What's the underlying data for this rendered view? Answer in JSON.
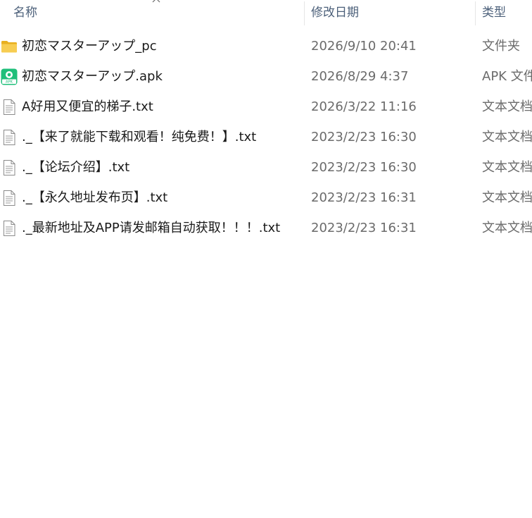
{
  "columns": {
    "name": "名称",
    "modified": "修改日期",
    "type": "类型"
  },
  "sort_icon": "chevron-up-icon",
  "files": [
    {
      "icon": "folder-icon",
      "name": "初恋マスターアップ_pc",
      "modified": "2026/9/10 20:41",
      "type": "文件夹"
    },
    {
      "icon": "apk-icon",
      "name": "初恋マスターアップ.apk",
      "modified": "2026/8/29 4:37",
      "type": "APK 文件"
    },
    {
      "icon": "text-file-icon",
      "name": "A好用又便宜的梯子.txt",
      "modified": "2026/3/22 11:16",
      "type": "文本文档"
    },
    {
      "icon": "text-file-icon",
      "name": "._【来了就能下载和观看！纯免费！】.txt",
      "modified": "2023/2/23 16:30",
      "type": "文本文档"
    },
    {
      "icon": "text-file-icon",
      "name": "._【论坛介绍】.txt",
      "modified": "2023/2/23 16:30",
      "type": "文本文档"
    },
    {
      "icon": "text-file-icon",
      "name": "._【永久地址发布页】.txt",
      "modified": "2023/2/23 16:31",
      "type": "文本文档"
    },
    {
      "icon": "text-file-icon",
      "name": "._最新地址及APP请发邮箱自动获取！！！.txt",
      "modified": "2023/2/23 16:31",
      "type": "文本文档"
    }
  ],
  "colors": {
    "header_text": "#4c607a",
    "date_text": "#6b6b6b",
    "folder": "#f5c542",
    "apk": "#1fbf7a"
  }
}
